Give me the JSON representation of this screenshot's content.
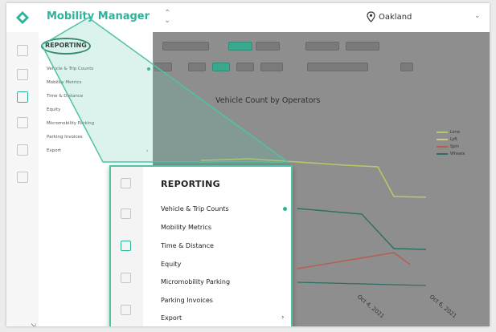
{
  "header": {
    "app_title": "Mobility Manager",
    "city": "Oakland",
    "logo_icon": "diamond-logo-icon",
    "accent_color": "#2ab49c"
  },
  "sidebar": {
    "section": "REPORTING",
    "items": [
      {
        "label": "Vehicle & Trip Counts",
        "active": true
      },
      {
        "label": "Mobility Metrics"
      },
      {
        "label": "Time & Distance"
      },
      {
        "label": "Equity"
      },
      {
        "label": "Micromobility Parking"
      },
      {
        "label": "Parking Invoices"
      },
      {
        "label": "Export",
        "has_submenu": true
      }
    ]
  },
  "zoom_menu": {
    "section": "REPORTING",
    "items": [
      {
        "label": "Vehicle & Trip Counts",
        "active": true
      },
      {
        "label": "Mobility Metrics"
      },
      {
        "label": "Time & Distance"
      },
      {
        "label": "Equity"
      },
      {
        "label": "Micromobility Parking"
      },
      {
        "label": "Parking Invoices"
      },
      {
        "label": "Export",
        "has_submenu": true
      }
    ]
  },
  "chart_data": {
    "type": "line",
    "title": "Vehicle Count by Operators",
    "x_labels": [
      "Oct 4, 2021",
      "Oct 6, 2021"
    ],
    "series": [
      {
        "name": "Lime",
        "color": "#b5c96a"
      },
      {
        "name": "Lyft",
        "color": "#c9cc80"
      },
      {
        "name": "Spin",
        "color": "#b95b4f"
      },
      {
        "name": "Wheels",
        "color": "#2c6e63"
      }
    ]
  }
}
